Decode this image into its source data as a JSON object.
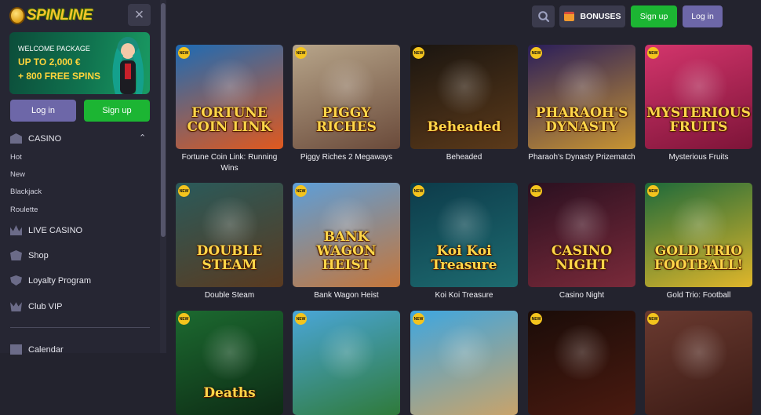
{
  "sidebar": {
    "logo_text": "SPINLINE",
    "close_icon": "×",
    "promo": {
      "line1": "WELCOME PACKAGE",
      "line2": "UP TO 2,000 €",
      "line3": "+ 800 FREE SPINS"
    },
    "login_label": "Log in",
    "signup_label": "Sign up",
    "casino_label": "CASINO",
    "chevron": "⌃",
    "casino_sub": [
      "Hot",
      "New",
      "Blackjack",
      "Roulette"
    ],
    "nav": [
      "LIVE CASINO",
      "Shop",
      "Loyalty Program",
      "Club VIP"
    ],
    "calendar_label": "Calendar"
  },
  "header": {
    "bonuses_label": "BONUSES",
    "signup_label": "Sign up",
    "login_label": "Log in"
  },
  "badge_text": "NEW",
  "games": [
    {
      "name": "Fortune Coin Link: Running Wins",
      "name_line1": "Fortune Coin Link: Running",
      "name_line2": "Wins",
      "art": "FORTUNE COIN LINK",
      "bg1": "#1e6bb4",
      "bg2": "#e0591e"
    },
    {
      "name": "Piggy Riches 2 Megaways",
      "art": "PIGGY RICHES",
      "bg1": "#b7a58a",
      "bg2": "#6a4a3a"
    },
    {
      "name": "Beheaded",
      "art": "Beheaded",
      "bg1": "#1a1510",
      "bg2": "#5c3a1a"
    },
    {
      "name": "Pharaoh's Dynasty Prizematch",
      "art": "PHARAOH'S DYNASTY",
      "bg1": "#2a1e5a",
      "bg2": "#c89432"
    },
    {
      "name": "Mysterious Fruits",
      "art": "MYSTERIOUS FRUITS",
      "bg1": "#d3356c",
      "bg2": "#7d1438"
    },
    {
      "name": "Double Steam",
      "art": "DOUBLE STEAM",
      "bg1": "#2a5a5a",
      "bg2": "#5a3a20"
    },
    {
      "name": "Bank Wagon Heist",
      "art": "BANK WAGON HEIST",
      "bg1": "#5d9ed8",
      "bg2": "#c5763a"
    },
    {
      "name": "Koi Koi Treasure",
      "art": "Koi Koi Treasure",
      "bg1": "#0d3b4a",
      "bg2": "#1d6b70"
    },
    {
      "name": "Casino Night",
      "art": "CASINO NIGHT",
      "bg1": "#2a1020",
      "bg2": "#7a2a3a"
    },
    {
      "name": "Gold Trio: Football",
      "art": "GOLD TRIO FOOTBALL!",
      "bg1": "#1e6a3a",
      "bg2": "#e0b62a"
    },
    {
      "name": "",
      "art": "Deaths",
      "bg1": "#1c6a30",
      "bg2": "#0d2a14"
    },
    {
      "name": "",
      "art": "",
      "bg1": "#4aa6d8",
      "bg2": "#2f7a3a"
    },
    {
      "name": "",
      "art": "",
      "bg1": "#3ea6e0",
      "bg2": "#c9a36a"
    },
    {
      "name": "",
      "art": "",
      "bg1": "#1a0c08",
      "bg2": "#4a1a10"
    },
    {
      "name": "",
      "art": "",
      "bg1": "#6a3a30",
      "bg2": "#3a1a14"
    }
  ]
}
